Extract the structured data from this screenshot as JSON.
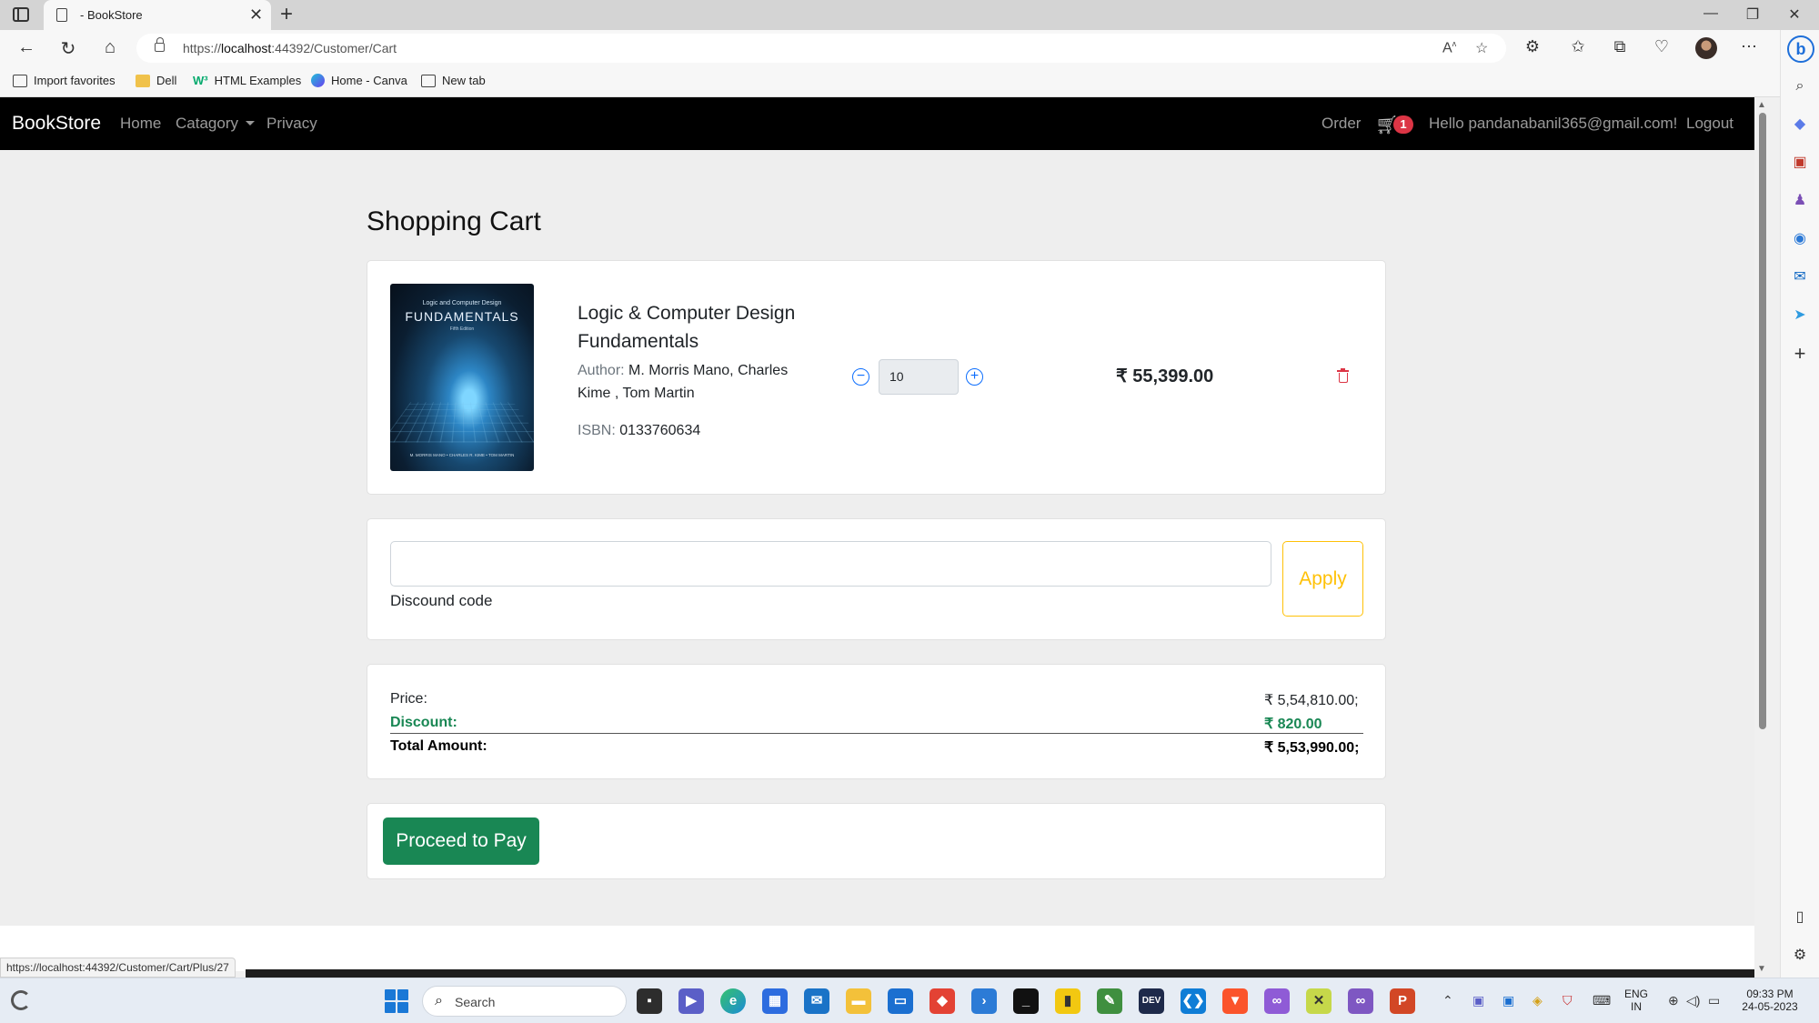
{
  "browser": {
    "tab_title": "- BookStore",
    "tab_close": "✕",
    "new_tab": "+",
    "url_prefix": "https://",
    "url_host": "localhost",
    "url_rest": ":44392/Customer/Cart",
    "status_url": "https://localhost:44392/Customer/Cart/Plus/27",
    "favorites": [
      {
        "label": "Import favorites",
        "icon": "import-icon"
      },
      {
        "label": "Dell",
        "icon": "folder-icon"
      },
      {
        "label": "HTML Examples",
        "icon": "w3schools-icon"
      },
      {
        "label": "Home - Canva",
        "icon": "canva-icon"
      },
      {
        "label": "New tab",
        "icon": "new-tab-page-icon"
      }
    ]
  },
  "navbar": {
    "brand": "BookStore",
    "links": [
      "Home",
      "Catagory",
      "Privacy"
    ],
    "order": "Order",
    "cart_count": "1",
    "greeting": "Hello pandanabanil365@gmail.com!",
    "logout": "Logout"
  },
  "page": {
    "title": "Shopping Cart"
  },
  "cart_item": {
    "cover": {
      "top_line": "Logic and Computer Design",
      "title": "FUNDAMENTALS",
      "edition": "Fifth Edition",
      "authors": "M. MORRIS MANO • CHARLES R. KIME • TOM MARTIN"
    },
    "name": "Logic & Computer Design Fundamentals",
    "author_label": "Author:",
    "author": "M. Morris Mano, Charles Kime , Tom Martin",
    "isbn_label": "ISBN:",
    "isbn": "0133760634",
    "quantity": "10",
    "price": "₹ 55,399.00"
  },
  "coupon": {
    "value": "",
    "label": "Discound code",
    "apply": "Apply"
  },
  "summary": {
    "price_label": "Price:",
    "price_value": "₹ 5,54,810.00;",
    "discount_label": "Discount:",
    "discount_value": "₹ 820.00",
    "total_label": "Total Amount:",
    "total_value": "₹ 5,53,990.00;"
  },
  "checkout": {
    "button": "Proceed to Pay"
  },
  "taskbar": {
    "search_placeholder": "Search",
    "lang_top": "ENG",
    "lang_bottom": "IN",
    "time": "09:33 PM",
    "date": "24-05-2023"
  },
  "colors": {
    "navbar_bg": "#000000",
    "success": "#198754",
    "warning": "#ffc107",
    "danger": "#dc3545",
    "primary": "#0d6efd"
  }
}
